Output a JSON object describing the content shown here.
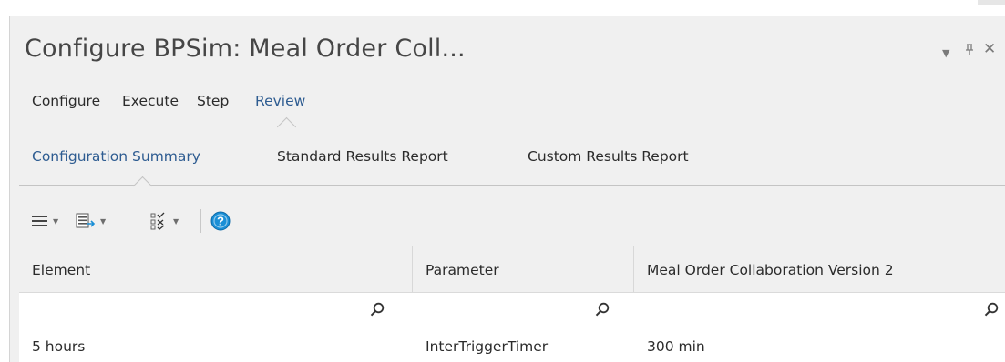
{
  "window": {
    "title": "Configure BPSim: Meal Order Coll...",
    "controls": {
      "dropdown": "▼",
      "pin": "ᵖ",
      "close": "✕"
    }
  },
  "nav": {
    "items": [
      "Configure",
      "Execute",
      "Step",
      "Review"
    ],
    "active": "Review"
  },
  "subnav": {
    "items": [
      "Configuration Summary",
      "Standard Results Report",
      "Custom Results Report"
    ],
    "active": "Configuration Summary"
  },
  "toolbar": {
    "buttons": [
      "menu-icon",
      "export-icon",
      "checklist-icon",
      "help-icon"
    ]
  },
  "grid": {
    "columns": [
      "Element",
      "Parameter",
      "Meal Order Collaboration Version 2"
    ],
    "rows": [
      {
        "element": "5 hours",
        "parameter": "InterTriggerTimer",
        "value": "300 min"
      }
    ]
  },
  "colors": {
    "accent": "#2e5c91",
    "help_icon": "#1a8fd6",
    "panel_bg": "#f0f0f0"
  }
}
